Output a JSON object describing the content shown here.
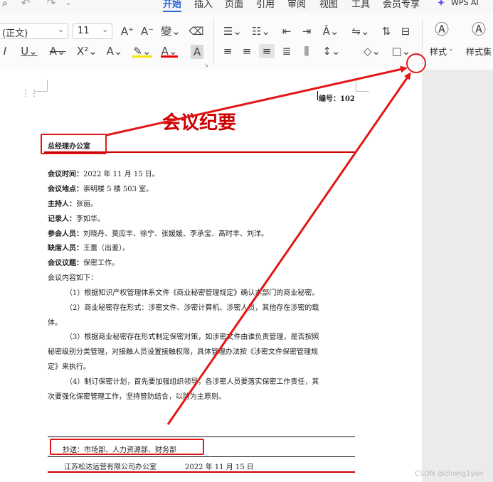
{
  "menu_tabs": [
    "开始",
    "插入",
    "页面",
    "引用",
    "审阅",
    "视图",
    "工具",
    "会员专享"
  ],
  "wps_ai_label": "WPS AI",
  "font_name": "(正文)",
  "font_size": "11",
  "styles_label": "样式",
  "style_set_label": "样式集",
  "icons": [
    "search-icon",
    "undo-icon",
    "redo-icon",
    "increase-font-icon",
    "decrease-font-icon",
    "phonetic-icon",
    "eraser-icon",
    "bullets-icon",
    "numbering-icon",
    "outdent-icon",
    "indent-icon",
    "text-direction-icon",
    "line-spacing-icon",
    "sort-icon",
    "border-icon",
    "italic-icon",
    "underline-icon",
    "strikethrough-icon",
    "superscript-icon",
    "text-effect-icon",
    "highlight-icon",
    "font-color-icon",
    "char-shading-icon",
    "align-left-icon",
    "align-center-icon",
    "align-right-icon",
    "justify-icon",
    "distributed-icon",
    "shading-icon",
    "styles-icon",
    "style-set-icon",
    "dialog-launcher-icon"
  ],
  "doc": {
    "number_label": "编号：102",
    "title": "会议纪要",
    "department": "总经理办公室",
    "meeting_time_label": "会议时间：",
    "meeting_time": "2022 年 11 月 15 日。",
    "meeting_place_label": "会议地点：",
    "meeting_place": "崇明楼 5 楼 503 室。",
    "host_label": "主持人：",
    "host": "张丽。",
    "recorder_label": "记录人：",
    "recorder": "李如华。",
    "attendees_label": "参会人员：",
    "attendees": "刘晓丹、莫应丰、徐宁、张媛媛、李承宝、高时丰、刘洋。",
    "absent_label": "缺席人员：",
    "absent": "王蕾（出差）。",
    "topic_label": "会议议题：",
    "topic": "保密工作。",
    "content_intro": "会议内容如下：",
    "p1": "（1）根据知识产权管理体系文件《商业秘密管理规定》确认本部门的商业秘密。",
    "p2a": "（2）商业秘密存在形式：涉密文件、涉密计算机、涉密人员，其他存在涉密的载",
    "p2b": "体。",
    "p3a": "（3）根据商业秘密存在形式制定保密对策，如涉密文件由谁负责管理，是否按照",
    "p3b": "秘密级别分类管理，对接触人员设置接触权限，具体管理办法按《涉密文件保密管理规",
    "p3c": "定》来执行。",
    "p4a": "（4）制订保密计划，首先要加强组织领导，各涉密人员要落实保密工作责任，其",
    "p4b": "次要强化保密管理工作，坚持管防结合，以防为主原则。",
    "cc": "抄送：市场部、人力资源部、财务部",
    "footer_org": "江苏松达运营有限公司办公室",
    "footer_date": "2022 年 11 月 15 日"
  },
  "watermark": "CSDN @zhong1yan"
}
